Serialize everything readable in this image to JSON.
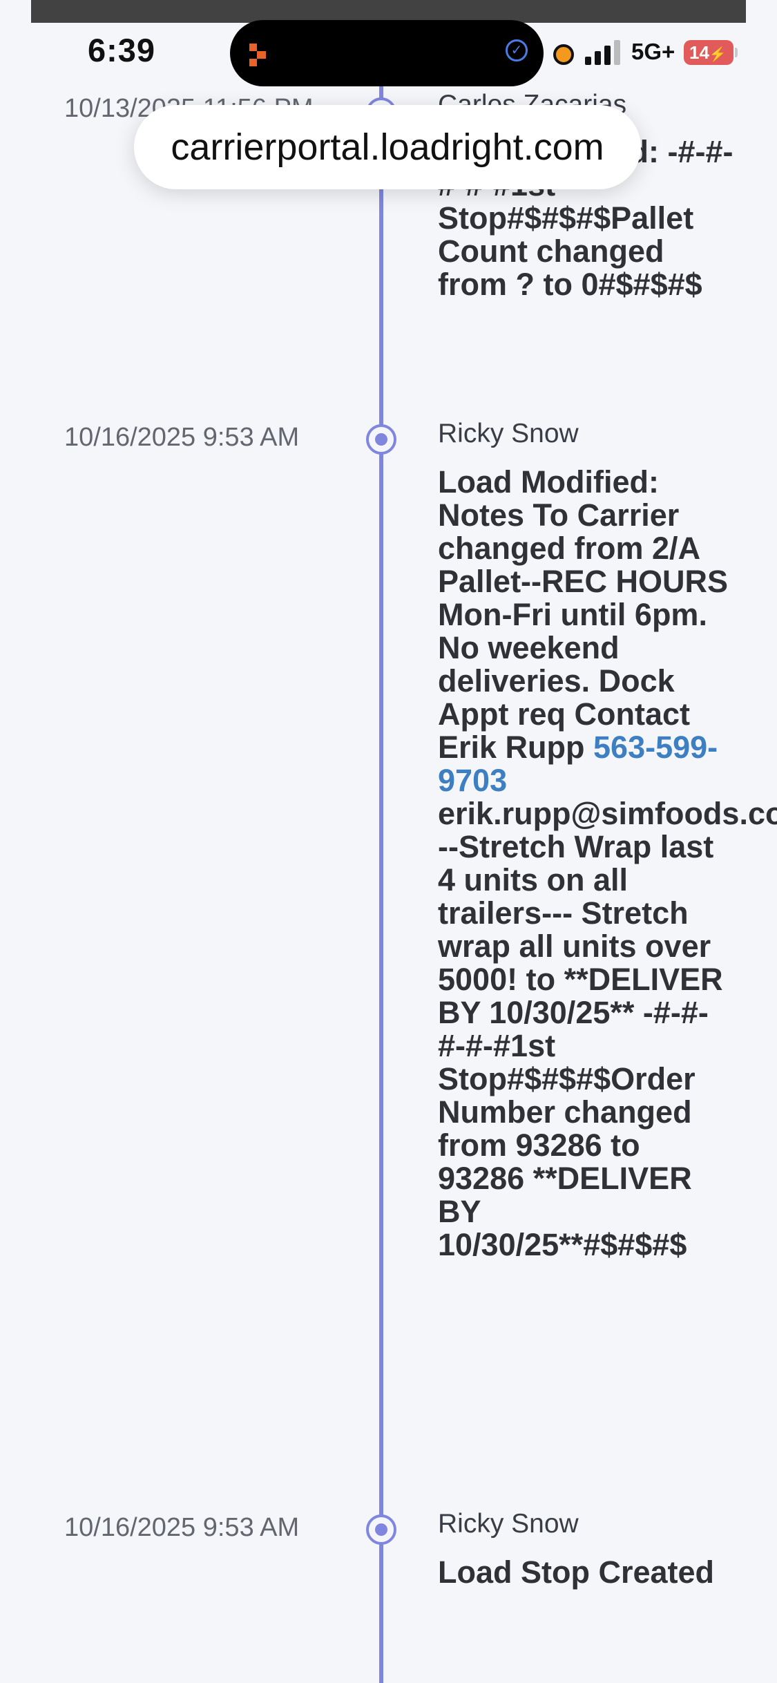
{
  "status_bar": {
    "time": "6:39",
    "network": "5G+",
    "battery": "14"
  },
  "browser": {
    "url": "carrierportal.loadright.com"
  },
  "entries": [
    {
      "date": "10/13/2025 11:56 PM",
      "author": "Carlos Zacarias",
      "message": "Load Modified: -#-#-#-#-#1st Stop#$#$#$Pallet Count changed from ? to 0#$#$#$"
    },
    {
      "date": "10/16/2025 9:53 AM",
      "author": "Ricky Snow",
      "message_before_phone": "Load Modified: Notes To Carrier changed from 2/A Pallet--REC HOURS Mon-Fri until 6pm. No weekend deliveries. Dock Appt req Contact Erik Rupp ",
      "phone": "563-599-9703",
      "email": "erik.rupp@simfoods.com",
      "message_after_email": "--Stretch Wrap last 4 units on all trailers--- Stretch wrap all units over 5000! to **DELIVER BY 10/30/25** -#-#-#-#-#1st Stop#$#$#$Order Number changed from 93286 to 93286 **DELIVER BY 10/30/25**#$#$#$"
    },
    {
      "date": "10/16/2025 9:53 AM",
      "author": "Ricky Snow",
      "message": "Load Stop Created"
    }
  ]
}
